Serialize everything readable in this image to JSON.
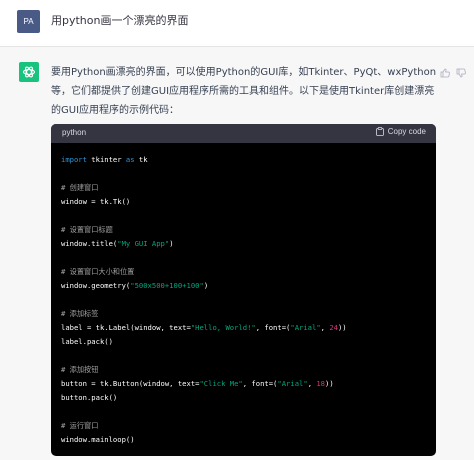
{
  "user": {
    "avatar": "PA",
    "message": "用python画一个漂亮的界面"
  },
  "assistant": {
    "intro": "要用Python画漂亮的界面，可以使用Python的GUI库，如Tkinter、PyQt、wxPython等，它们都提供了创建GUI应用程序所需的工具和组件。以下是使用Tkinter库创建漂亮的GUI应用程序的示例代码：",
    "actions": [
      "thumbs-up-icon",
      "thumbs-down-icon"
    ]
  },
  "code": {
    "language": "python",
    "copy_label": "Copy code",
    "lines": {
      "l1_kw1": "import",
      "l1_mid": " tkinter ",
      "l1_kw2": "as",
      "l1_end": " tk",
      "c1": "# 创建窗口",
      "l2": "window = tk.Tk()",
      "c2": "# 设置窗口标题",
      "l3_a": "window.title(",
      "l3_s": "\"My GUI App\"",
      "l3_b": ")",
      "c3": "# 设置窗口大小和位置",
      "l4_a": "window.geometry(",
      "l4_s": "\"500x500+100+100\"",
      "l4_b": ")",
      "c4": "# 添加标签",
      "l5_a": "label = tk.Label(window, text=",
      "l5_s1": "\"Hello, World!\"",
      "l5_b": ", font=(",
      "l5_s2": "\"Arial\"",
      "l5_c": ", ",
      "l5_n": "24",
      "l5_d": "))",
      "l6": "label.pack()",
      "c5": "# 添加按钮",
      "l7_a": "button = tk.Button(window, text=",
      "l7_s1": "\"Click Me\"",
      "l7_b": ", font=(",
      "l7_s2": "\"Arial\"",
      "l7_c": ", ",
      "l7_n": "18",
      "l7_d": "))",
      "l8": "button.pack()",
      "c6": "# 运行窗口",
      "l9": "window.mainloop()"
    }
  },
  "colors": {
    "bot_avatar": "#19c37d",
    "user_avatar": "#4a5a86",
    "code_bg": "#000000",
    "keyword": "#2e95d3",
    "string": "#00a67d",
    "number": "#df3079"
  }
}
